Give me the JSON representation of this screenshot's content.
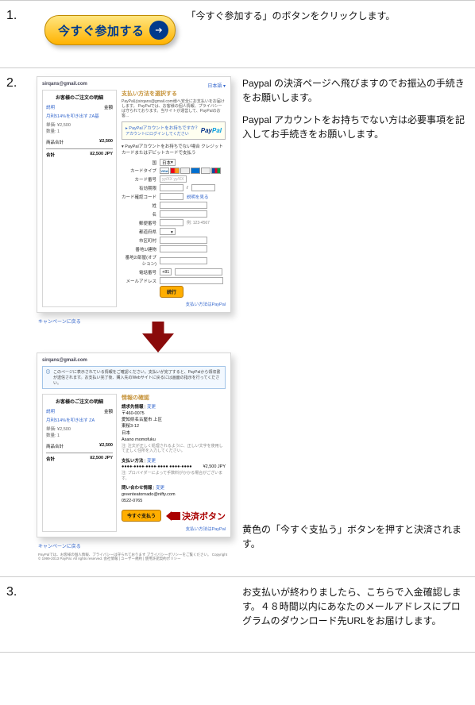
{
  "steps": {
    "s1": {
      "num": "1.",
      "btn": "今すぐ参加する",
      "text": "「今すぐ参加する」のボタンをクリックします。"
    },
    "s2": {
      "num": "2.",
      "text1": "Paypal の決済ページへ飛びますのでお振込の手続きをお願いします。",
      "text2": "Paypal アカウントをお持ちでない方は必要事項を記入してお手続きをお願いします。",
      "panel1": {
        "email": "sirqans@gmail.com",
        "lang": "日本語 ▾",
        "order": {
          "title": "お客様のご注文の明細",
          "line1_lbl": "説明",
          "line1_amt": "金額",
          "item": "月利514%を叩き出す ZA基",
          "price": "単価: ¥2,500",
          "qty": "数量: 1",
          "sub_lbl": "商品合計",
          "sub_amt": "¥2,500",
          "total_lbl": "合計",
          "total_amt": "¥2,500 JPY"
        },
        "pay_heading": "支払い方法を選択する",
        "pay_desc": "PayPalはsirqans@gmail.com様へ安全にお支払いをお届けします。\nPayPalでは、お客様の個人情報、プライバシーは守られております。当サイトが運営して、PayPalのお客...",
        "pp_login": "▸ PayPalアカウントをお持ちですか？",
        "pp_login2": "アカウントにログインしてください",
        "form_intro": "▾ PayPalアカウントをお持ちでない場合\nクレジットカードまたはデビットカードで支払う",
        "labels": {
          "country": "国",
          "country_val": "日本",
          "cardtype": "カードタイプ",
          "cardno": "カード番号",
          "cardno_ph": "yy/XX   yy/XX",
          "exp": "有効期限",
          "csc": "カード確認コード",
          "csc_link": "説明を見る",
          "sei": "姓",
          "mei": "名",
          "zip": "郵便番号",
          "zip_ph": "例: 123-4567",
          "pref": "都道府県",
          "city": "市区町村",
          "addr1": "番地1/建物",
          "addr2": "番地2/部屋(オプション)",
          "tel": "電話番号",
          "tel_pre": "+81",
          "email": "メールアドレス"
        },
        "submit": "続行",
        "foot": "支払い方法はPayPal"
      },
      "panel2": {
        "email": "sirqans@gmail.com",
        "notice": "このページに表示されている情報をご確認ください。支払いが完了すると、PayPalから領収書が送信されます。お支払い完了後、購入先のWebサイトに戻るには画面の指示を行ってください。",
        "order": {
          "title": "お客様のご注文の明細",
          "line1_lbl": "説明",
          "line1_amt": "金額",
          "item": "月利514%を叩き出す ZA",
          "price": "単価: ¥2,500",
          "qty": "数量: 1",
          "sub_lbl": "商品合計",
          "sub_amt": "¥2,500",
          "total_lbl": "合計",
          "total_amt": "¥2,500 JPY"
        },
        "confirm_title": "情報の確認",
        "addr_h": "請求先情報",
        "mod": "変更",
        "addr_zip": "〒460-0075",
        "addr_l1": "愛知県名古屋市 上区",
        "addr_l2": "東桜3-12",
        "addr_l3": "日本",
        "addr_name": "Asano momofuku",
        "addr_note": "注: 注文が正しく処理されるように、正しい文字を使用して正しく住所を入力してください。",
        "pay_h": "支払い方法",
        "pay_line": "●●●●-●●●●-●●●●-●●●● ●●●●-●●●●",
        "pay_amt": "¥2,500 JPY",
        "pay_note": "注: プロバイダーによって手数料がかかる場合がございます。",
        "contact_h": "問い合わせ情報",
        "contact_email": "greenteatornado@nifty.com",
        "contact_tel": "0522-0765",
        "pay_now": "今すぐ支払う",
        "pay_now_label": "決済ボタン",
        "foot": "支払い方法はPayPal",
        "offer": "キャンペーンに戻る",
        "legal": "PayPalでは、お客様の個人情報、プライバシーは守られております プライバシーポリシーをご覧ください。\nCopyright © 1999-2013 PayPal. All rights reserved. 会社情報 | ユーザー規約 | 使用許諾契約ポリシー"
      },
      "text3": "黄色の「今すぐ支払う」ボタンを押すと決済されます。"
    },
    "s3": {
      "num": "3.",
      "text": "お支払いが終わりましたら、こちらで入金確認します。４８時間以内にあなたのメールアドレスにプログラムのダウンロード先URLをお届けします。"
    }
  }
}
